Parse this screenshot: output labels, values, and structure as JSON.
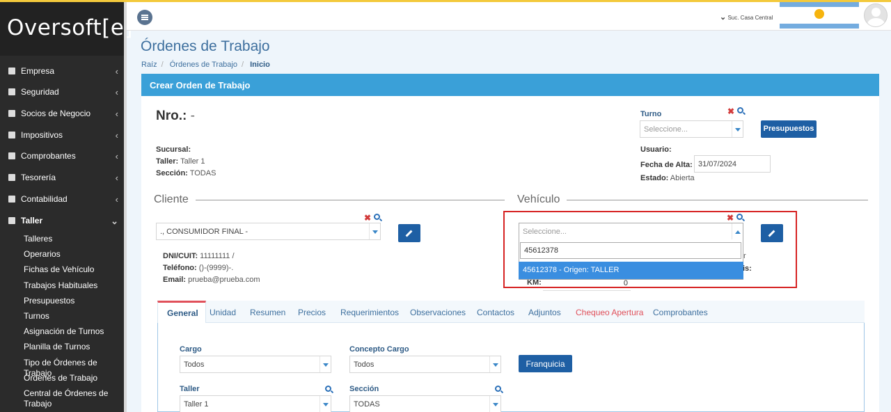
{
  "app": {
    "logo": "Oversoft[e]"
  },
  "header": {
    "branch": "Suc. Casa Central"
  },
  "sidebar": {
    "items": [
      {
        "label": "Empresa",
        "icon": "building-icon"
      },
      {
        "label": "Seguridad",
        "icon": "lock-icon"
      },
      {
        "label": "Socios de Negocio",
        "icon": "user-icon"
      },
      {
        "label": "Impositivos",
        "icon": "percent-icon"
      },
      {
        "label": "Comprobantes",
        "icon": "receipt-icon"
      },
      {
        "label": "Tesorería",
        "icon": "money-icon"
      },
      {
        "label": "Contabilidad",
        "icon": "calculator-icon"
      },
      {
        "label": "Taller",
        "icon": "wrench-icon"
      }
    ],
    "subitems": [
      "Talleres",
      "Operarios",
      "Fichas de Vehículo",
      "Trabajos Habituales",
      "Presupuestos",
      "Turnos",
      "Asignación de Turnos",
      "Planilla de Turnos",
      "Tipo de Órdenes de Trabajo",
      "Órdenes de Trabajo",
      "Central de Órdenes de Trabajo"
    ]
  },
  "page": {
    "title": "Órdenes de Trabajo",
    "breadcrumb": [
      "Raíz",
      "Órdenes de Trabajo",
      "Inicio"
    ],
    "panel_title": "Crear Orden de Trabajo"
  },
  "form": {
    "nro_label": "Nro.:",
    "nro_value": "-",
    "sucursal_label": "Sucursal:",
    "taller_label": "Taller:",
    "taller_value": "Taller 1",
    "seccion_label": "Sección:",
    "seccion_value": "TODAS",
    "turno_label": "Turno",
    "turno_placeholder": "Seleccione...",
    "presupuestos_btn": "Presupuestos",
    "usuario_label": "Usuario:",
    "fecha_label": "Fecha de Alta:",
    "fecha_value": "31/07/2024",
    "estado_label": "Estado:",
    "estado_value": "Abierta"
  },
  "cliente": {
    "title": "Cliente",
    "selected": "., CONSUMIDOR FINAL -",
    "dni_label": "DNI/CUIT:",
    "dni_value": "11111111 /",
    "tel_label": "Teléfono:",
    "tel_value": "()-(9999)-.",
    "email_label": "Email:",
    "email_value": "prueba@prueba.com"
  },
  "vehiculo": {
    "title": "Vehículo",
    "placeholder": "Seleccione...",
    "search_value": "45612378",
    "option": "45612378 - Origen: TALLER",
    "km_label": "KM:",
    "km_value": "0",
    "hidden_r": "r",
    "hidden_s": "is:"
  },
  "tabs": [
    "General",
    "Unidad",
    "Resumen",
    "Precios",
    "Requerimientos",
    "Observaciones",
    "Contactos",
    "Adjuntos",
    "Chequeo Apertura",
    "Comprobantes"
  ],
  "general": {
    "cargo_label": "Cargo",
    "cargo_value": "Todos",
    "concepto_label": "Concepto Cargo",
    "concepto_value": "Todos",
    "franquicia_btn": "Franquicia",
    "taller_label": "Taller",
    "taller_value": "Taller 1",
    "seccion_label": "Sección",
    "seccion_value": "TODAS"
  }
}
